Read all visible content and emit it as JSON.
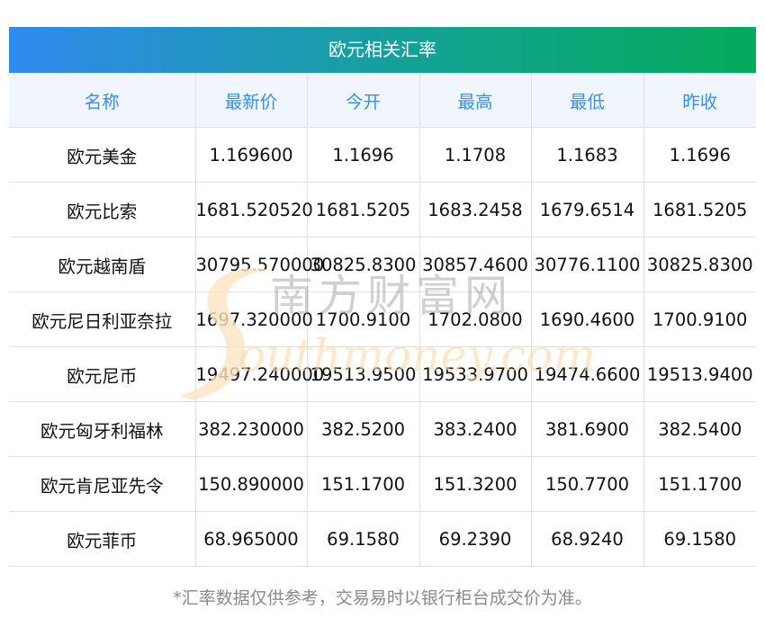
{
  "title": "欧元相关汇率",
  "columns": [
    "名称",
    "最新价",
    "今开",
    "最高",
    "最低",
    "昨收"
  ],
  "rows": [
    [
      "欧元美金",
      "1.169600",
      "1.1696",
      "1.1708",
      "1.1683",
      "1.1696"
    ],
    [
      "欧元比索",
      "1681.520520",
      "1681.5205",
      "1683.2458",
      "1679.6514",
      "1681.5205"
    ],
    [
      "欧元越南盾",
      "30795.570000",
      "30825.8300",
      "30857.4600",
      "30776.1100",
      "30825.8300"
    ],
    [
      "欧元尼日利亚奈拉",
      "1697.320000",
      "1700.9100",
      "1702.0800",
      "1690.4600",
      "1700.9100"
    ],
    [
      "欧元尼币",
      "19497.240000",
      "19513.9500",
      "19533.9700",
      "19474.6600",
      "19513.9400"
    ],
    [
      "欧元匈牙利福林",
      "382.230000",
      "382.5200",
      "383.2400",
      "381.6900",
      "382.5400"
    ],
    [
      "欧元肯尼亚先令",
      "150.890000",
      "151.1700",
      "151.3200",
      "150.7700",
      "151.1700"
    ],
    [
      "欧元菲币",
      "68.965000",
      "69.1580",
      "69.2390",
      "68.9240",
      "69.1580"
    ]
  ],
  "watermark": {
    "cn": "南方财富网",
    "en": "outhmoney.com"
  },
  "footer": "*汇率数据仅供参考，交易易时以银行柜台成交价为准。"
}
